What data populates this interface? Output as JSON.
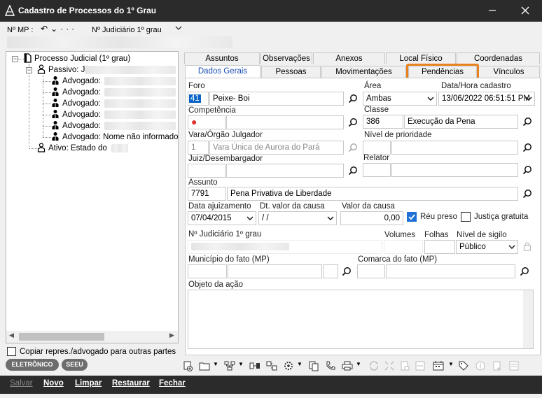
{
  "window": {
    "title": "Cadastro de Processos do 1º Grau"
  },
  "topbar": {
    "mp_label": "Nº MP :",
    "nj_label": "Nº Judiciário   1º grau"
  },
  "tree": {
    "root": "Processo Judicial (1º grau)",
    "passivo": "Passivo: J",
    "advogados": [
      "Advogado:",
      "Advogado:",
      "Advogado:",
      "Advogado:",
      "Advogado:",
      "Advogado: Nome não informado"
    ],
    "ativo": "Ativo: Estado do"
  },
  "copy_label": "Copiar repres./advogado para outras partes",
  "pills": {
    "eletronico": "ELETRÔNICO",
    "seeu": "SEEU"
  },
  "tabs_row1": [
    "Assuntos",
    "Observações",
    "Anexos",
    "Local Físico",
    "Coordenadas"
  ],
  "tabs_row2": [
    "Dados Gerais",
    "Pessoas",
    "Movimentações",
    "Pendências",
    "Vínculos"
  ],
  "form": {
    "foro": {
      "label": "Foro",
      "code": "41",
      "name": "Peixe- Boi"
    },
    "area": {
      "label": "Área",
      "value": "Ambas"
    },
    "data_hora": {
      "label": "Data/Hora cadastro",
      "value": "13/06/2022 06:51:51 PM"
    },
    "competencia": {
      "label": "Competência"
    },
    "classe": {
      "label": "Classe",
      "code": "386",
      "name": "Execução da Pena"
    },
    "vara": {
      "label": "Vara/Órgão Julgador",
      "code": "1",
      "name": "Vara Única de Aurora do Pará"
    },
    "nivel_prioridade": {
      "label": "Nível de prioridade"
    },
    "juiz": {
      "label": "Juiz/Desembargador"
    },
    "relator": {
      "label": "Relator"
    },
    "assunto": {
      "label": "Assunto",
      "code": "7791",
      "name": "Pena Privativa de Liberdade"
    },
    "data_ajuizamento": {
      "label": "Data ajuizamento",
      "value": "07/04/2015"
    },
    "dt_valor_causa": {
      "label": "Dt. valor da causa",
      "value": " /  /"
    },
    "valor_causa": {
      "label": "Valor da causa",
      "value": "0,00"
    },
    "reu_preso": {
      "label": "Réu preso"
    },
    "justica_gratuita": {
      "label": "Justiça gratuita"
    },
    "nj": {
      "label": "Nº Judiciário  1º grau"
    },
    "volumes": {
      "label": "Volumes"
    },
    "folhas": {
      "label": "Folhas"
    },
    "nivel_sigilo": {
      "label": "Nível de sigilo",
      "value": "Público"
    },
    "municipio": {
      "label": "Município do fato (MP)"
    },
    "comarca": {
      "label": "Comarca do fato (MP)"
    },
    "objeto": {
      "label": "Objeto da ação"
    }
  },
  "bottom": {
    "salvar": "Salvar",
    "novo": "Novo",
    "limpar": "Limpar",
    "restaurar": "Restaurar",
    "fechar": "Fechar"
  }
}
